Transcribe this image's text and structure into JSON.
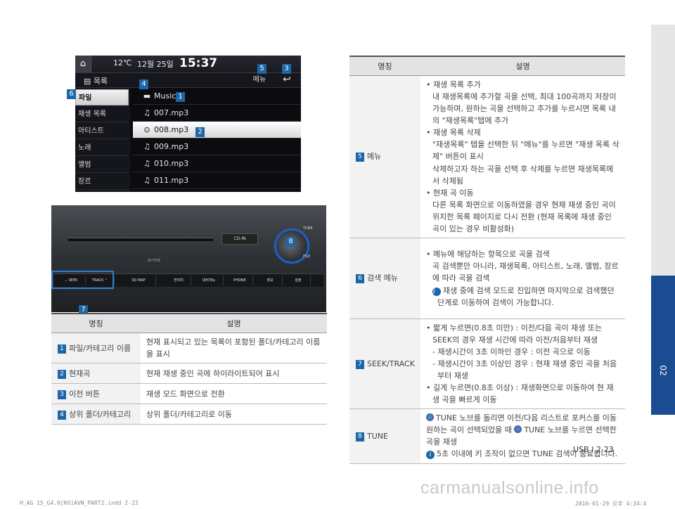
{
  "screen": {
    "temp": "12℃",
    "date": "12월 25일",
    "time": "15:37",
    "list_title": "목록",
    "menu_label": "메뉴",
    "back_glyph": "↩",
    "sidebar": [
      "파일",
      "재생 목록",
      "아티스트",
      "노래",
      "앨범",
      "장르"
    ],
    "folder": "Music",
    "tracks": [
      "007.mp3",
      "008.mp3",
      "009.mp3",
      "010.mp3",
      "011.mp3"
    ]
  },
  "unit": {
    "tune_label": "TUNE",
    "file_label": "FILE",
    "disc_label": "CD-IN",
    "brand": "ACTIVE",
    "buttons": [
      "SEEK",
      "TRACK",
      "MAP",
      "한미지",
      "내비게뉴",
      "PHONE",
      "정보",
      "설정"
    ],
    "sd_label": "SD"
  },
  "badges": [
    "1",
    "2",
    "3",
    "4",
    "5",
    "6",
    "7",
    "8"
  ],
  "table_left": {
    "headers": [
      "명칭",
      "설명"
    ],
    "rows": [
      {
        "num": "1",
        "name": "파일/카테고리 이름",
        "desc": "현재 표시되고 있는 목록이 포함된 폴더/카테고리 이름을 표시"
      },
      {
        "num": "2",
        "name": "현재곡",
        "desc": "현재 재생 중인 곡에 하이라이트되어 표시"
      },
      {
        "num": "3",
        "name": "이전 버튼",
        "desc": "재생 모드 화면으로 전환"
      },
      {
        "num": "4",
        "name": "상위 폴더/카테고리",
        "desc": "상위 폴더/카테고리로 이동"
      }
    ]
  },
  "table_right": {
    "headers": [
      "명칭",
      "설명"
    ],
    "r5": {
      "num": "5",
      "name": "메뉴",
      "lines": [
        "• 재생 목록 추가",
        "내 재생목록에 추가할 곡을 선택, 최대 100곡까지 저장이 가능하며, 원하는 곡을 선택하고 추가를 누르시면 목록 내의 \"재생목록\"탭에 추가",
        "• 재생 목록 삭제",
        "\"재생목록\" 탭을 선택한 뒤 \"메뉴\"를 누르면 \"재생 목록 삭제\" 버튼이 표시",
        "삭제하고자 하는 곡을 선택 후 삭제를 누르면 재생목록에서 삭제됨",
        "• 현재 곡 이동",
        "다른 목록 화면으로 이동하였을 경우 현재 재생 중인 곡이 위치한 목록 페이지로 다시 전환 (현재 목록에 재생 중인 곡이 있는 경우 비활성화)"
      ]
    },
    "r6": {
      "num": "6",
      "name": "검색 메뉴",
      "lines": [
        "• 메뉴에 해당하는 항목으로 곡을 검색",
        "곡 검색뿐만 아니라, 재생목록, 아티스트, 노래, 앨범, 장르에 따라 곡을 검색",
        "재생 중에 검색 모드로 진입하면 마지막으로 검색했던 단계로 이동하여 검색이 가능합니다."
      ]
    },
    "r7": {
      "num": "7",
      "name": "SEEK/TRACK",
      "lines": [
        "• 짧게 누르면(0.8초 미만) : 이전/다음 곡이 재생 또는 SEEK의 경우 재생 시간에 따라 이전/처음부터 재생",
        "- 재생시간이 3초 이하인 경우 : 이전 곡으로 이동",
        "- 재생시간이 3초 이상인 경우 : 현재 재생 중인 곡을 처음부터 재생",
        "• 길게 누르면(0.8초 이상) : 재생화면으로 이동하여 현 재생 곡을 빠르게 이동"
      ]
    },
    "r8": {
      "num": "8",
      "name": "TUNE",
      "tune_word": "TUNE",
      "text1": "노브를 돌리면 이전/다음 리스트로 포커스를 이동 원하는 곡이 선택되었을 때",
      "text2": "노브를 누르면 선택한 곡을 재생",
      "note": "5초 이내에 키 조작이 없으면 TUNE 검색이 종료됩니다."
    }
  },
  "page_number": "USB I 2-23",
  "chapter_tab": "02",
  "footer_left": "H_AG 15_G4.0[KO]AVN_PART2.indd   2-23",
  "footer_right": "2016-01-29   오후 4:34:4",
  "watermark": "carmanualsonline.info"
}
